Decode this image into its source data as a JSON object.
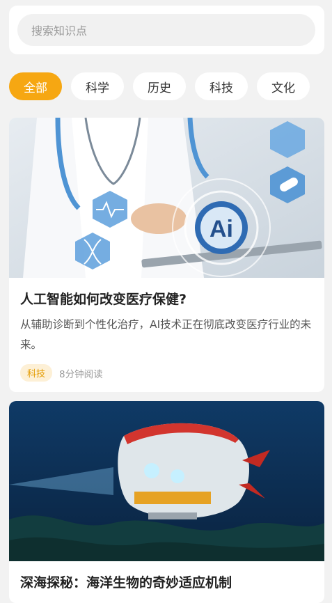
{
  "search": {
    "placeholder": "搜索知识点"
  },
  "categories": [
    {
      "label": "全部",
      "active": true
    },
    {
      "label": "科学",
      "active": false
    },
    {
      "label": "历史",
      "active": false
    },
    {
      "label": "科技",
      "active": false
    },
    {
      "label": "文化",
      "active": false
    }
  ],
  "articles": [
    {
      "title": "人工智能如何改变医疗保健?",
      "summary": "从辅助诊断到个性化治疗，AI技术正在彻底改变医疗行业的未来。",
      "tag": "科技",
      "read_time": "8分钟阅读",
      "image_badge": "Ai",
      "image_subject": "doctor-ai-illustration"
    },
    {
      "title": "深海探秘：海洋生物的奇妙适应机制",
      "image_subject": "deep-sea-submersible"
    }
  ],
  "colors": {
    "accent": "#f6a712",
    "tag_bg": "#fdf0d6",
    "tag_text": "#e49b00"
  }
}
